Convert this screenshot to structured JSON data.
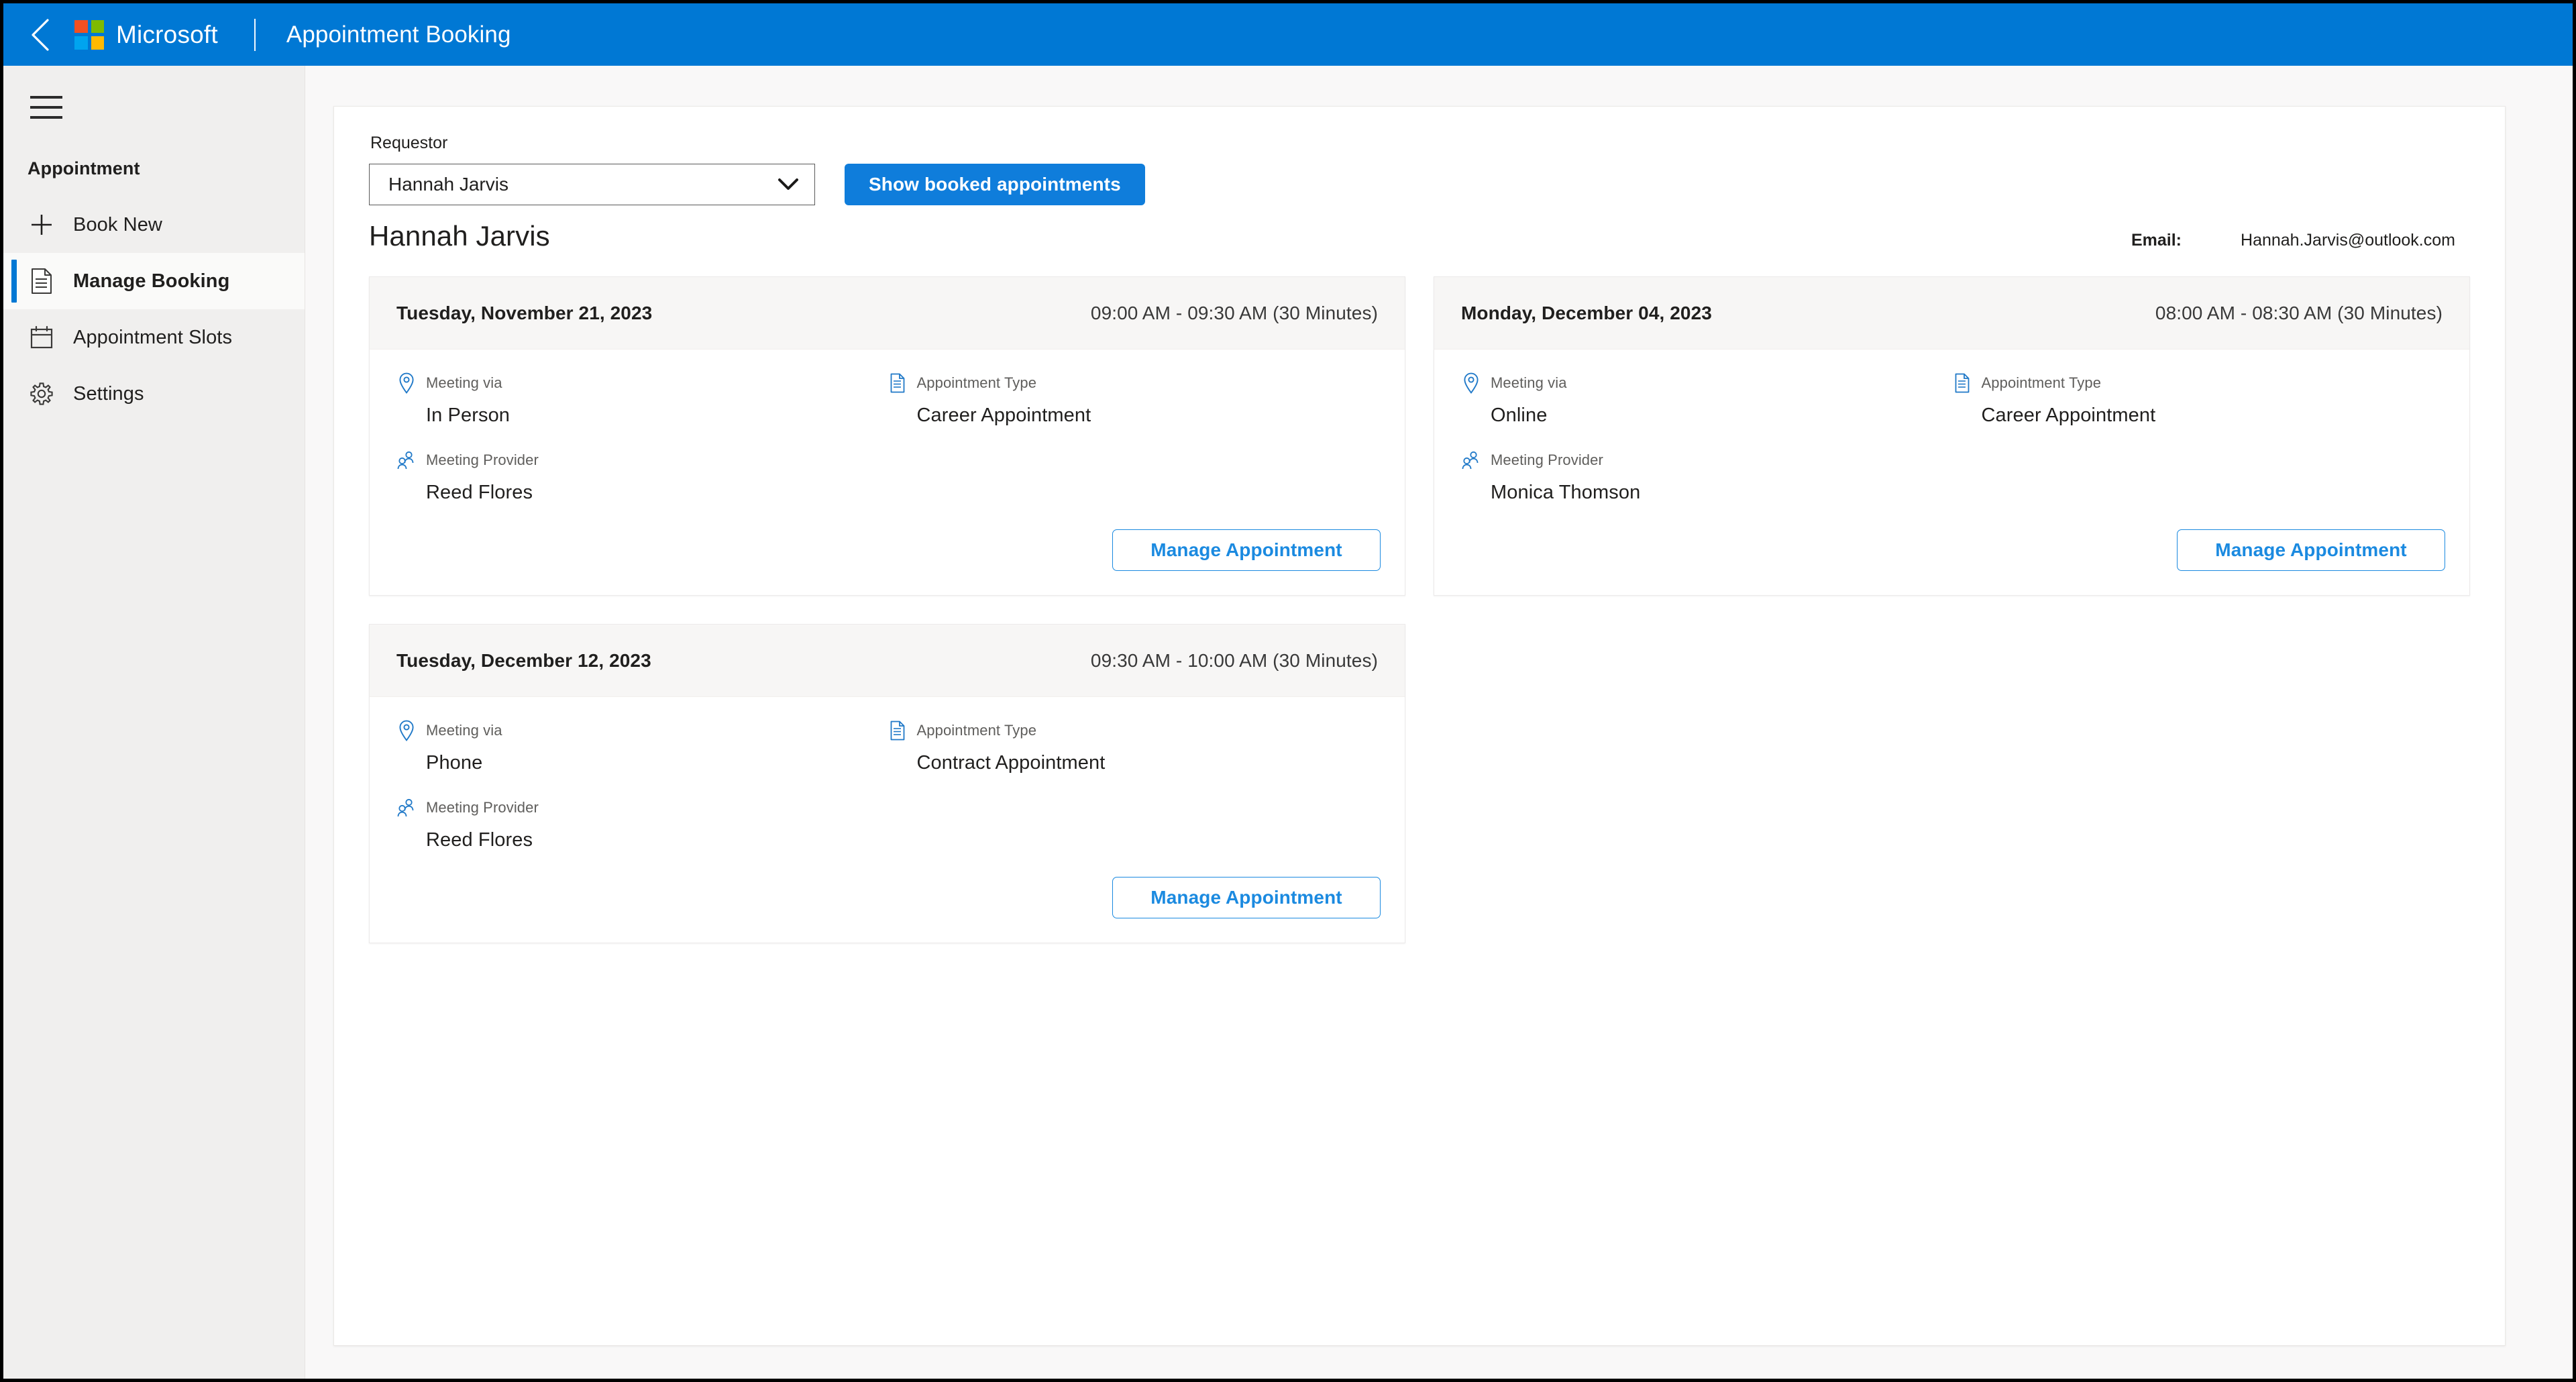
{
  "topbar": {
    "back_icon": "back-chevron-icon",
    "brand": "Microsoft",
    "app_title": "Appointment Booking",
    "brand_color": "#0078d4",
    "logo_colors": [
      "#f25022",
      "#7fba00",
      "#00a4ef",
      "#ffb900"
    ]
  },
  "sidebar": {
    "menu_icon": "hamburger-icon",
    "section_title": "Appointment",
    "items": [
      {
        "label": "Book New",
        "icon": "plus-icon",
        "selected": false
      },
      {
        "label": "Manage Booking",
        "icon": "document-icon",
        "selected": true
      },
      {
        "label": "Appointment Slots",
        "icon": "calendar-icon",
        "selected": false
      },
      {
        "label": "Settings",
        "icon": "gear-icon",
        "selected": false
      }
    ],
    "accent_color": "#0078d4"
  },
  "main": {
    "requestor_label": "Requestor",
    "requestor_select": {
      "value": "Hannah Jarvis",
      "placeholder": "Select requestor",
      "chevron_icon": "chevron-down-icon"
    },
    "show_button_label": "Show booked appointments",
    "person_name": "Hannah Jarvis",
    "email_label": "Email:",
    "email_value": "Hannah.Jarvis@outlook.com",
    "field_labels": {
      "meeting_via": "Meeting via",
      "appointment_type": "Appointment Type",
      "meeting_provider": "Meeting Provider"
    },
    "manage_button_label": "Manage Appointment",
    "appointments": [
      {
        "date": "Tuesday, November 21, 2023",
        "time": "09:00 AM - 09:30 AM (30 Minutes)",
        "meeting_via": "In Person",
        "appointment_type": "Career Appointment",
        "meeting_provider": "Reed Flores"
      },
      {
        "date": "Monday, December 04, 2023",
        "time": "08:00 AM - 08:30 AM (30 Minutes)",
        "meeting_via": "Online",
        "appointment_type": "Career Appointment",
        "meeting_provider": "Monica Thomson"
      },
      {
        "date": "Tuesday, December 12, 2023",
        "time": "09:30 AM - 10:00 AM (30 Minutes)",
        "meeting_via": "Phone",
        "appointment_type": "Contract Appointment",
        "meeting_provider": "Reed Flores"
      }
    ]
  }
}
